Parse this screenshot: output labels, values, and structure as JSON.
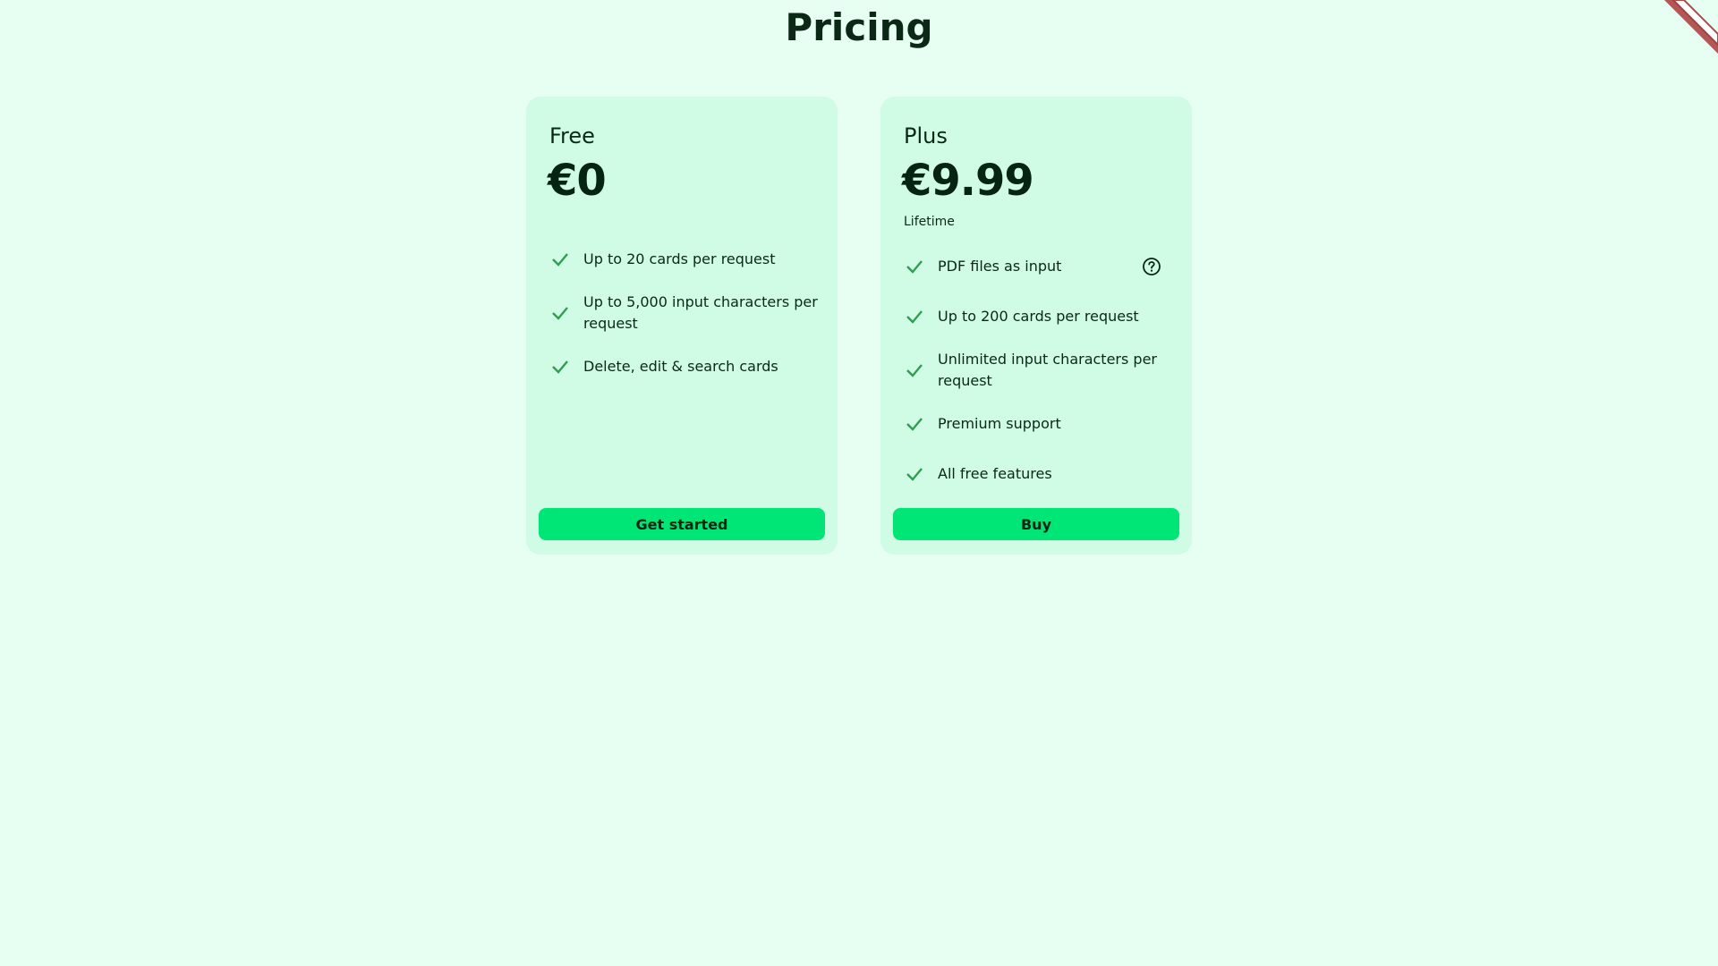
{
  "page": {
    "title": "Pricing"
  },
  "colors": {
    "background": "#e6fff2",
    "card": "#d0fce6",
    "accent": "#00e676",
    "check": "#2e9e4f"
  },
  "plans": [
    {
      "name": "Free",
      "price": "€0",
      "period": "",
      "features": [
        {
          "text": "Up to 20 cards per request"
        },
        {
          "text": "Up to 5,000 input characters per request"
        },
        {
          "text": "Delete, edit & search cards"
        }
      ],
      "cta": "Get started"
    },
    {
      "name": "Plus",
      "price": "€9.99",
      "period": "Lifetime",
      "features": [
        {
          "text": "PDF files as input",
          "icon": "help-circle-icon"
        },
        {
          "text": "Up to 200 cards per request"
        },
        {
          "text": "Unlimited input characters per request"
        },
        {
          "text": "Premium support"
        },
        {
          "text": "All free features"
        }
      ],
      "cta": "Buy"
    }
  ]
}
